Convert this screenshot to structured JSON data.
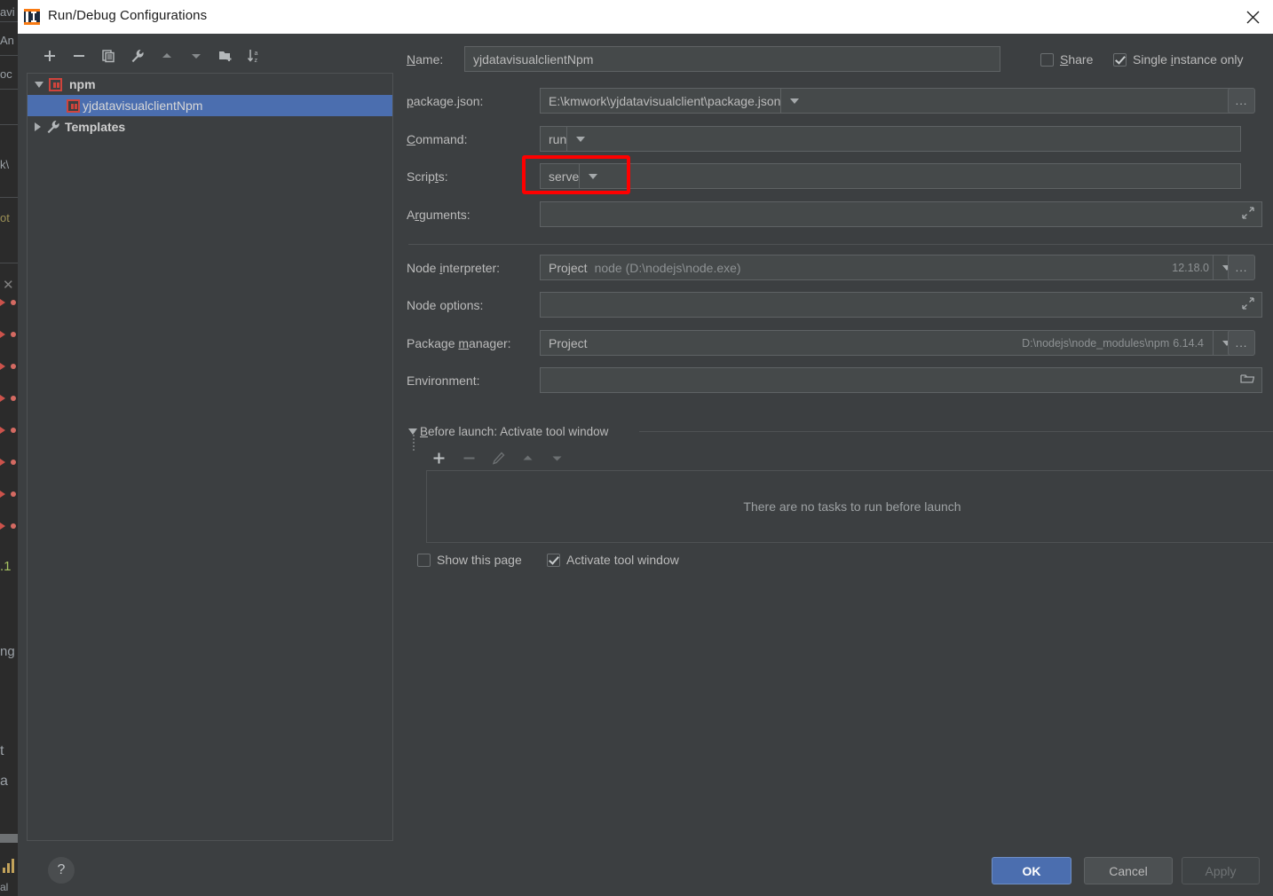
{
  "window": {
    "title": "Run/Debug Configurations",
    "close_icon": "close-icon",
    "app_icon": "intellij-idea-icon"
  },
  "left_panel": {
    "toolbar": [
      {
        "name": "add",
        "icon": "plus-icon"
      },
      {
        "name": "remove",
        "icon": "minus-icon"
      },
      {
        "name": "copy",
        "icon": "copy-icon"
      },
      {
        "name": "edit-templates",
        "icon": "wrench-icon"
      },
      {
        "name": "move-up",
        "icon": "arrow-up-icon"
      },
      {
        "name": "move-down",
        "icon": "arrow-down-icon"
      },
      {
        "name": "new-folder",
        "icon": "folder-add-icon"
      },
      {
        "name": "sort-alphabetically",
        "icon": "sort-az-icon"
      }
    ],
    "tree": [
      {
        "label": "npm",
        "level": 0,
        "expanded": true,
        "icon": "npm-icon",
        "selected": false,
        "bold": true
      },
      {
        "label": "yjdatavisualclientNpm",
        "level": 1,
        "expanded": null,
        "icon": "npm-icon",
        "selected": true,
        "bold": false
      },
      {
        "label": "Templates",
        "level": 0,
        "expanded": false,
        "icon": "wrench-icon",
        "selected": false,
        "bold": true
      }
    ]
  },
  "form": {
    "name": {
      "label_pre": "N",
      "label_mn": "",
      "label": "Name:",
      "value": "yjdatavisualclientNpm"
    },
    "share": {
      "label": "Share",
      "mnemonic": "S",
      "checked": false
    },
    "single_instance": {
      "label": "Single instance only",
      "mnemonic": "i",
      "checked": true
    },
    "package_json": {
      "label": "package.json:",
      "value": "E:\\kmwork\\yjdatavisualclient\\package.json",
      "browse_label": "..."
    },
    "command": {
      "label": "Command:",
      "value": "run"
    },
    "scripts": {
      "label": "Scripts:",
      "value": "serve"
    },
    "arguments": {
      "label": "Arguments:",
      "value": ""
    },
    "node_interpreter": {
      "label": "Node interpreter:",
      "value": "Project",
      "detail": "node (D:\\nodejs\\node.exe)",
      "version": "12.18.0",
      "browse_label": "..."
    },
    "node_options": {
      "label": "Node options:",
      "value": ""
    },
    "package_manager": {
      "label": "Package manager:",
      "value": "Project",
      "detail": "D:\\nodejs\\node_modules\\npm",
      "version": "6.14.4",
      "browse_label": "..."
    },
    "environment": {
      "label": "Environment:",
      "value": ""
    }
  },
  "before_launch": {
    "title": "Before launch: Activate tool window",
    "title_mnemonic": "B",
    "toolbar": [
      {
        "name": "add-task",
        "icon": "plus-icon",
        "enabled": true
      },
      {
        "name": "remove-task",
        "icon": "minus-icon",
        "enabled": false
      },
      {
        "name": "edit-task",
        "icon": "pencil-icon",
        "enabled": false
      },
      {
        "name": "move-task-up",
        "icon": "arrow-up-icon",
        "enabled": false
      },
      {
        "name": "move-task-down",
        "icon": "arrow-down-icon",
        "enabled": false
      }
    ],
    "empty_text": "There are no tasks to run before launch",
    "show_this_page": {
      "label": "Show this page",
      "checked": false
    },
    "activate_tool_window": {
      "label": "Activate tool window",
      "checked": true
    }
  },
  "footer": {
    "help_label": "?",
    "ok": "OK",
    "cancel": "Cancel",
    "apply": "Apply"
  },
  "annotation": {
    "color": "#fe0000",
    "target": "scripts-field"
  },
  "ide_background": {
    "fragments": [
      "avi",
      "An",
      "oc",
      "k\\",
      "ot",
      "t",
      "a",
      "ng",
      ".1",
      "al"
    ]
  }
}
